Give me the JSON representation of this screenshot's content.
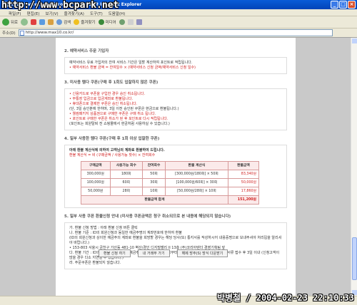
{
  "window": {
    "title": "http://www.max10.co.kr/ - Microsoft Internet Explorer",
    "watermark_top": "http://www.bcpark.net",
    "watermark_bottom": "박병철 / 2004-02-23 22:10:33"
  },
  "menu": [
    "파일(F)",
    "편집(E)",
    "보기(V)",
    "즐겨찾기(A)",
    "도구(T)",
    "도움말(H)"
  ],
  "toolbar": {
    "back": "뒤로",
    "search": "검색",
    "favorites": "즐겨찾기",
    "media": "미디어"
  },
  "address": {
    "label": "주소(D)",
    "url": "http://www.max10.co.kr/"
  },
  "sections": [
    {
      "heading": "2. 예약서비스 주문 기입자",
      "lines": [
        {
          "text": "예약서비스 유료 가입자의 잔여 서비스 기간은 일할 계산하여 포인트로 적립됩니다.",
          "red": false
        },
        {
          "text": "• 예약서비스 환불 금액 = 잔여일수 × (예약서비스 신청 금액/예약서비스 신청 일수)",
          "red": true
        }
      ]
    },
    {
      "heading": "3. 미사용 템다 쿠폰(구매 후 1회도 입찰하지 않은 쿠폰)",
      "lines": [
        {
          "text": "• 신용카드로 쿠폰을 구입한 경우 승인 취소됩니다.",
          "red": true
        },
        {
          "text": "• 무통장 입금으로 입금계좌로 환불됩니다.",
          "red": true
        },
        {
          "text": "• 휴대폰으로 결제한 쿠폰은 승인 취소됩니다.",
          "red": true
        },
        {
          "text": "  (단, 3일 승인분에 한하며, 3일 이전 승인된 쿠폰은 현금으로 환불됩니다.)",
          "red": false
        },
        {
          "text": "• 웰컴패키지 상품권으로 구매한 쿠폰은 구매 취소 됩니다.",
          "red": true
        },
        {
          "text": "• 포인트로 구매한 쿠폰은 취소가 된 후 포인트로 다시 적립됩니다.",
          "red": true
        },
        {
          "text": "  (포인트는 회원탈퇴 전 쇼핑몰에서 현금처럼 사용하실 수 있습니다.)",
          "red": false
        }
      ]
    },
    {
      "heading": "4. 일부 사용한 템다 쿠폰(구매 후 1회 이상 입찰한 쿠폰)",
      "intro": "아래 환불 계산식에 의하여 고객님의 계좌로 환불하여 드립니다.",
      "formula": "환불 계산식 = 비 (구매금액 / 사용가능 횟수) × 잔여회수",
      "table": {
        "headers": [
          "구매금액",
          "사용가능 회수",
          "잔여회수",
          "환불 계산식",
          "환불금액"
        ],
        "rows": [
          [
            "300,000원",
            "180회",
            "50회",
            "[300,000원/180회] × 50회",
            "83,340원"
          ],
          [
            "100,000원",
            "60회",
            "30회",
            "[100,000원/60회] × 30회",
            "50,000원"
          ],
          [
            "50,000원",
            "28회",
            "10회",
            "[50,000원/28회] × 10회",
            "17,860원"
          ]
        ],
        "total_label": "환불금액 합계",
        "total_value": "151,200원"
      }
    },
    {
      "heading": "5. 일부 사용 쿠폰 환불신청 안내 (미사용 쿠폰금액은 청구 취소되므로 본 내용에 해당되지 않습니다)",
      "lines": [
        {
          "text": "가. 환불 신청 방법 : 아래 환불 신청 버튼 클릭",
          "red": false
        },
        {
          "text": "나. 환불 기준 : ID의 회원신청과 동일한 예금주명의 계좌번호에 한하여 환불",
          "red": false
        },
        {
          "text": "   (ID의 회원신청과 상이한 예금주의 계좌로 환불을 희망할 경우는 해당 당사(또) 통지서를 작성하시어 내용증명으로 보내주셔야 처리됩을 알리셔야 바랍니다.)",
          "red": false
        },
        {
          "text": "   • 153-803 서울시 금천구 가산동 481-10 벽산/경인 디지털밸리 II 13층 (주)코리아텐더 경영기획팀 앞",
          "red": false
        },
        {
          "text": "다. 환불 기간 : ID의 회원신청과 동일한 예금주명의 환불을 신청일로부터 3일 이내이고, 그외 경우는 보장 서류 접수 후 3일 이내 (신청고객이 많을 경우 다소 지연될 수 있습니다.)",
          "red": false
        },
        {
          "text": "라. 주문쿠폰은 환불되지 않습니다.",
          "red": false
        }
      ]
    }
  ],
  "buttons": [
    "환불 신청 하기",
    "내 거래부 가기",
    "해제 방주(S) 방식 다운받기"
  ]
}
